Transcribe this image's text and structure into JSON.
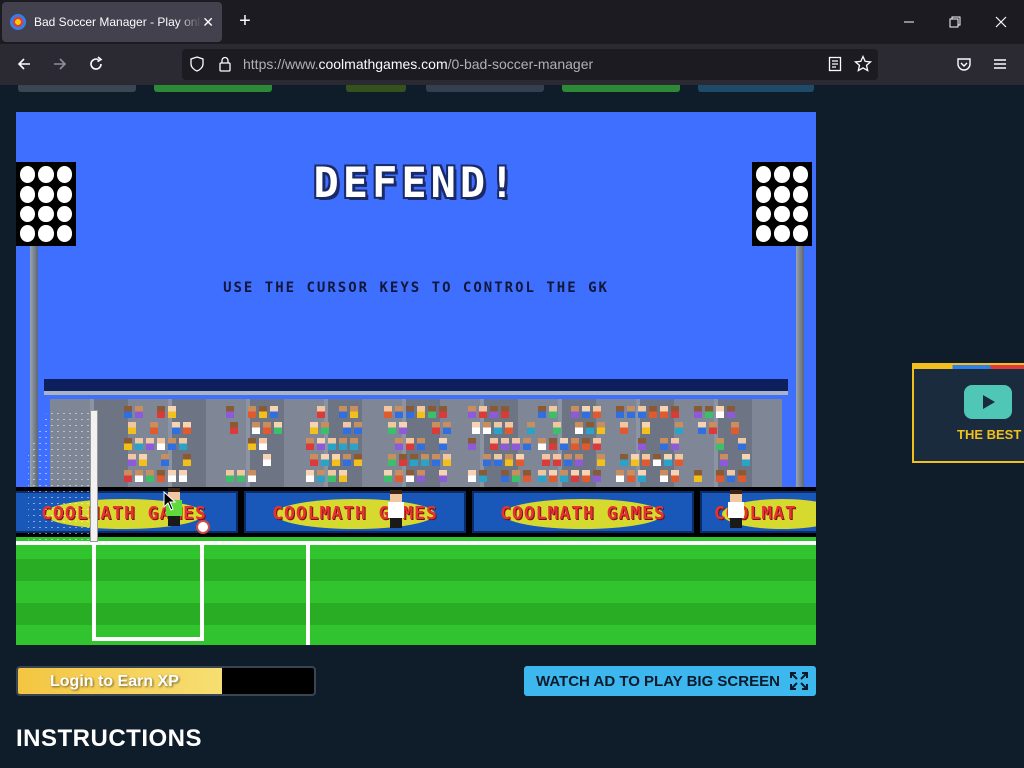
{
  "browser": {
    "tab_title": "Bad Soccer Manager - Play online",
    "url_scheme": "https://www.",
    "url_host": "coolmathgames.com",
    "url_path": "/0-bad-soccer-manager"
  },
  "game": {
    "headline": "DEFEND!",
    "hint": "USE THE CURSOR KEYS TO CONTROL THE GK",
    "board_text": "COOLMATH GAMES",
    "board_text_partial": "COOLMAT"
  },
  "below_game": {
    "xp_label": "Login to Earn XP",
    "xp_progress": 0.69,
    "big_screen_label": "WATCH AD TO PLAY BIG SCREEN",
    "instructions_heading": "INSTRUCTIONS"
  },
  "side_ad": {
    "text": "THE BEST"
  },
  "colors": {
    "page_bg": "#0f1d2b",
    "game_sky": "#3f6fff",
    "pitch_green": "#32c42e",
    "accent_blue": "#3cb8ef",
    "xp_yellow": "#f4c542"
  }
}
